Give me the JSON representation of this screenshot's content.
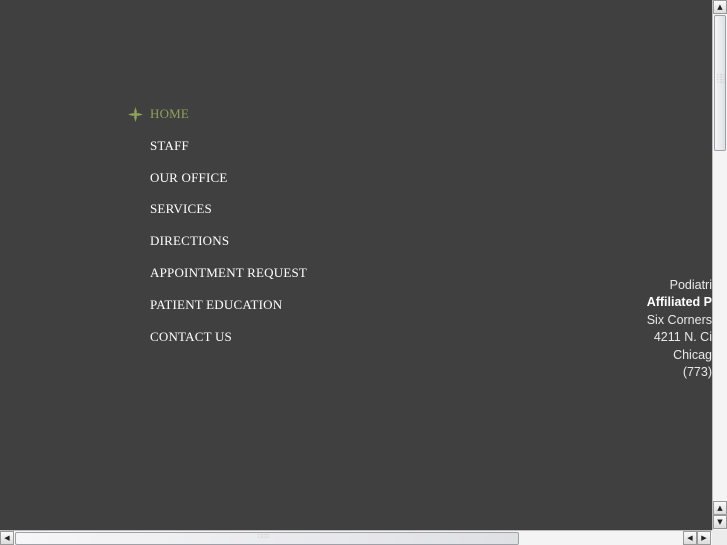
{
  "nav": {
    "items": [
      {
        "label": "HOME",
        "active": true
      },
      {
        "label": "STAFF"
      },
      {
        "label": "OUR OFFICE"
      },
      {
        "label": "SERVICES"
      },
      {
        "label": "DIRECTIONS"
      },
      {
        "label": "APPOINTMENT REQUEST"
      },
      {
        "label": "PATIENT EDUCATION"
      },
      {
        "label": "CONTACT US"
      }
    ],
    "active_color": "#8fa25a",
    "bullet_icon": "cross-flower-icon"
  },
  "address": {
    "line1": "Podiatri",
    "line2": "Affiliated P",
    "line3": "Six Corners",
    "line4": "4211 N. Ci",
    "line5": "Chicag",
    "line6": "(773)"
  },
  "colors": {
    "background": "#404040",
    "text": "#ffffff"
  }
}
